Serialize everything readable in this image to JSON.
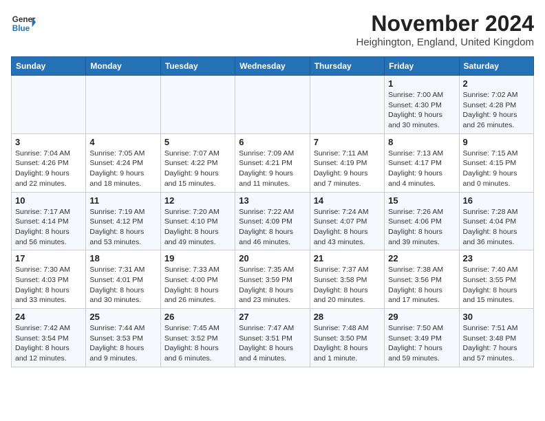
{
  "header": {
    "logo_line1": "General",
    "logo_line2": "Blue",
    "month_year": "November 2024",
    "location": "Heighington, England, United Kingdom"
  },
  "days_of_week": [
    "Sunday",
    "Monday",
    "Tuesday",
    "Wednesday",
    "Thursday",
    "Friday",
    "Saturday"
  ],
  "weeks": [
    [
      {
        "day": "",
        "info": ""
      },
      {
        "day": "",
        "info": ""
      },
      {
        "day": "",
        "info": ""
      },
      {
        "day": "",
        "info": ""
      },
      {
        "day": "",
        "info": ""
      },
      {
        "day": "1",
        "info": "Sunrise: 7:00 AM\nSunset: 4:30 PM\nDaylight: 9 hours\nand 30 minutes."
      },
      {
        "day": "2",
        "info": "Sunrise: 7:02 AM\nSunset: 4:28 PM\nDaylight: 9 hours\nand 26 minutes."
      }
    ],
    [
      {
        "day": "3",
        "info": "Sunrise: 7:04 AM\nSunset: 4:26 PM\nDaylight: 9 hours\nand 22 minutes."
      },
      {
        "day": "4",
        "info": "Sunrise: 7:05 AM\nSunset: 4:24 PM\nDaylight: 9 hours\nand 18 minutes."
      },
      {
        "day": "5",
        "info": "Sunrise: 7:07 AM\nSunset: 4:22 PM\nDaylight: 9 hours\nand 15 minutes."
      },
      {
        "day": "6",
        "info": "Sunrise: 7:09 AM\nSunset: 4:21 PM\nDaylight: 9 hours\nand 11 minutes."
      },
      {
        "day": "7",
        "info": "Sunrise: 7:11 AM\nSunset: 4:19 PM\nDaylight: 9 hours\nand 7 minutes."
      },
      {
        "day": "8",
        "info": "Sunrise: 7:13 AM\nSunset: 4:17 PM\nDaylight: 9 hours\nand 4 minutes."
      },
      {
        "day": "9",
        "info": "Sunrise: 7:15 AM\nSunset: 4:15 PM\nDaylight: 9 hours\nand 0 minutes."
      }
    ],
    [
      {
        "day": "10",
        "info": "Sunrise: 7:17 AM\nSunset: 4:14 PM\nDaylight: 8 hours\nand 56 minutes."
      },
      {
        "day": "11",
        "info": "Sunrise: 7:19 AM\nSunset: 4:12 PM\nDaylight: 8 hours\nand 53 minutes."
      },
      {
        "day": "12",
        "info": "Sunrise: 7:20 AM\nSunset: 4:10 PM\nDaylight: 8 hours\nand 49 minutes."
      },
      {
        "day": "13",
        "info": "Sunrise: 7:22 AM\nSunset: 4:09 PM\nDaylight: 8 hours\nand 46 minutes."
      },
      {
        "day": "14",
        "info": "Sunrise: 7:24 AM\nSunset: 4:07 PM\nDaylight: 8 hours\nand 43 minutes."
      },
      {
        "day": "15",
        "info": "Sunrise: 7:26 AM\nSunset: 4:06 PM\nDaylight: 8 hours\nand 39 minutes."
      },
      {
        "day": "16",
        "info": "Sunrise: 7:28 AM\nSunset: 4:04 PM\nDaylight: 8 hours\nand 36 minutes."
      }
    ],
    [
      {
        "day": "17",
        "info": "Sunrise: 7:30 AM\nSunset: 4:03 PM\nDaylight: 8 hours\nand 33 minutes."
      },
      {
        "day": "18",
        "info": "Sunrise: 7:31 AM\nSunset: 4:01 PM\nDaylight: 8 hours\nand 30 minutes."
      },
      {
        "day": "19",
        "info": "Sunrise: 7:33 AM\nSunset: 4:00 PM\nDaylight: 8 hours\nand 26 minutes."
      },
      {
        "day": "20",
        "info": "Sunrise: 7:35 AM\nSunset: 3:59 PM\nDaylight: 8 hours\nand 23 minutes."
      },
      {
        "day": "21",
        "info": "Sunrise: 7:37 AM\nSunset: 3:58 PM\nDaylight: 8 hours\nand 20 minutes."
      },
      {
        "day": "22",
        "info": "Sunrise: 7:38 AM\nSunset: 3:56 PM\nDaylight: 8 hours\nand 17 minutes."
      },
      {
        "day": "23",
        "info": "Sunrise: 7:40 AM\nSunset: 3:55 PM\nDaylight: 8 hours\nand 15 minutes."
      }
    ],
    [
      {
        "day": "24",
        "info": "Sunrise: 7:42 AM\nSunset: 3:54 PM\nDaylight: 8 hours\nand 12 minutes."
      },
      {
        "day": "25",
        "info": "Sunrise: 7:44 AM\nSunset: 3:53 PM\nDaylight: 8 hours\nand 9 minutes."
      },
      {
        "day": "26",
        "info": "Sunrise: 7:45 AM\nSunset: 3:52 PM\nDaylight: 8 hours\nand 6 minutes."
      },
      {
        "day": "27",
        "info": "Sunrise: 7:47 AM\nSunset: 3:51 PM\nDaylight: 8 hours\nand 4 minutes."
      },
      {
        "day": "28",
        "info": "Sunrise: 7:48 AM\nSunset: 3:50 PM\nDaylight: 8 hours\nand 1 minute."
      },
      {
        "day": "29",
        "info": "Sunrise: 7:50 AM\nSunset: 3:49 PM\nDaylight: 7 hours\nand 59 minutes."
      },
      {
        "day": "30",
        "info": "Sunrise: 7:51 AM\nSunset: 3:48 PM\nDaylight: 7 hours\nand 57 minutes."
      }
    ]
  ]
}
